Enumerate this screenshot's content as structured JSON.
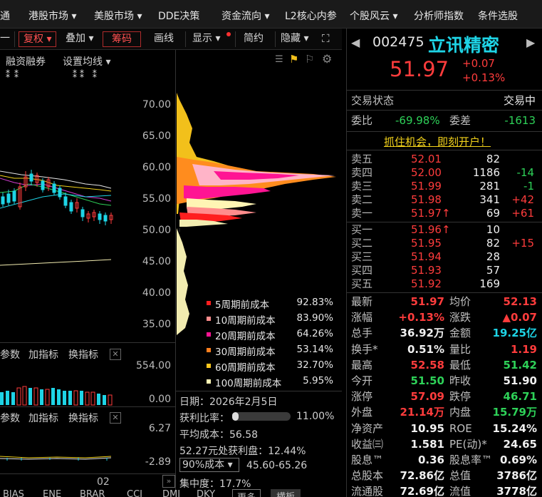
{
  "nav": {
    "items": [
      "通",
      "港股市场",
      "美股市场",
      "DDE决策",
      "资金流向",
      "L2核心内参",
      "个股风云",
      "分析师指数",
      "条件选股"
    ]
  },
  "toolbar": {
    "dash": "一",
    "fuquan": "复权",
    "diejia": "叠加",
    "chouma": "筹码",
    "huaxian": "画线",
    "xianshi": "显示",
    "jianyue": "简约",
    "yincang": "隐藏"
  },
  "subtoolbar": {
    "rongzi": "融资融券",
    "junxian": "设置均线"
  },
  "price_axis": [
    "70.00",
    "65.00",
    "60.00",
    "55.00",
    "50.00",
    "45.00",
    "40.00",
    "35.00"
  ],
  "chip_legend": [
    {
      "label": "5周期前成本",
      "value": "92.83%",
      "color": "#ff1e1e"
    },
    {
      "label": "10周期前成本",
      "value": "83.90%",
      "color": "#ff8c8c"
    },
    {
      "label": "20周期前成本",
      "value": "64.26%",
      "color": "#ff1493"
    },
    {
      "label": "30周期前成本",
      "value": "53.14%",
      "color": "#ff7f1e"
    },
    {
      "label": "60周期前成本",
      "value": "32.70%",
      "color": "#ffc81e"
    },
    {
      "label": "100周期前成本",
      "value": "5.95%",
      "color": "#fff5b4"
    }
  ],
  "vol_panel": {
    "params": "参数",
    "add": "加指标",
    "swap": "换指标",
    "close": "✕",
    "axis_top": "554.00",
    "axis_bottom": "0.00"
  },
  "macd_panel": {
    "params": "参数",
    "add": "加指标",
    "swap": "换指标",
    "close": "✕",
    "axis_top": "6.27",
    "axis_bottom": "-2.89"
  },
  "date_axis": {
    "label": "02"
  },
  "chip_info": {
    "date": "日期：2026年2月5日",
    "profit_label": "获利比率：",
    "profit_value": "11.00%",
    "avg_cost": "平均成本：56.58",
    "profit_at": "52.27元处获利盘：12.44%",
    "select": "90%成本",
    "range": "45.60-65.26",
    "concentration": "集中度：17.7%"
  },
  "bottom_tabs": [
    "BIAS",
    "ENE",
    "BRAR",
    "CCI",
    "DMI",
    "DKY",
    "更多",
    "横板"
  ],
  "stock": {
    "code": "002475",
    "name": "立讯精密",
    "price": "51.97",
    "change": "+0.07",
    "pct": "+0.13%"
  },
  "status": {
    "label": "交易状态",
    "value": "交易中"
  },
  "weibi": {
    "label": "委比",
    "value": "-69.98%",
    "diff_label": "委差",
    "diff_value": "-1613"
  },
  "promo": "抓住机会，即刻开户！",
  "asks": [
    {
      "label": "卖五",
      "price": "52.01",
      "vol": "82",
      "chg": ""
    },
    {
      "label": "卖四",
      "price": "52.00",
      "vol": "1186",
      "chg": "-14"
    },
    {
      "label": "卖三",
      "price": "51.99",
      "vol": "281",
      "chg": "-1"
    },
    {
      "label": "卖二",
      "price": "51.98",
      "vol": "341",
      "chg": "+42"
    },
    {
      "label": "卖一",
      "price": "51.97↑",
      "vol": "69",
      "chg": "+61"
    }
  ],
  "bids": [
    {
      "label": "买一",
      "price": "51.96↑",
      "vol": "10",
      "chg": ""
    },
    {
      "label": "买二",
      "price": "51.95",
      "vol": "82",
      "chg": "+15"
    },
    {
      "label": "买三",
      "price": "51.94",
      "vol": "28",
      "chg": ""
    },
    {
      "label": "买四",
      "price": "51.93",
      "vol": "57",
      "chg": ""
    },
    {
      "label": "买五",
      "price": "51.92",
      "vol": "169",
      "chg": ""
    }
  ],
  "stats": [
    {
      "l1": "最新",
      "v1": "51.97",
      "c1": "red",
      "l2": "均价",
      "v2": "52.13",
      "c2": "red"
    },
    {
      "l1": "涨幅",
      "v1": "+0.13%",
      "c1": "red",
      "l2": "涨跌",
      "v2": "▲0.07",
      "c2": "red"
    },
    {
      "l1": "总手",
      "v1": "36.92万",
      "c1": "white",
      "l2": "金额",
      "v2": "19.25亿",
      "c2": "cyan"
    },
    {
      "l1": "换手*",
      "v1": "0.51%",
      "c1": "white",
      "l2": "量比",
      "v2": "1.19",
      "c2": "red"
    },
    {
      "l1": "最高",
      "v1": "52.58",
      "c1": "red",
      "l2": "最低",
      "v2": "51.42",
      "c2": "green"
    },
    {
      "l1": "今开",
      "v1": "51.50",
      "c1": "green",
      "l2": "昨收",
      "v2": "51.90",
      "c2": "white"
    },
    {
      "l1": "涨停",
      "v1": "57.09",
      "c1": "red",
      "l2": "跌停",
      "v2": "46.71",
      "c2": "green"
    },
    {
      "l1": "外盘",
      "v1": "21.14万",
      "c1": "red",
      "l2": "内盘",
      "v2": "15.79万",
      "c2": "green"
    },
    {
      "l1": "净资产",
      "v1": "10.95",
      "c1": "white",
      "l2": "ROE",
      "v2": "15.24%",
      "c2": "white"
    },
    {
      "l1": "收益㈢",
      "v1": "1.581",
      "c1": "white",
      "l2": "PE(动)*",
      "v2": "24.65",
      "c2": "white"
    },
    {
      "l1": "股息™",
      "v1": "0.36",
      "c1": "white",
      "l2": "股息率™",
      "v2": "0.69%",
      "c2": "white"
    },
    {
      "l1": "总股本",
      "v1": "72.86亿",
      "c1": "white",
      "l2": "总值",
      "v2": "3786亿",
      "c2": "white"
    },
    {
      "l1": "流通股",
      "v1": "72.69亿",
      "c1": "white",
      "l2": "流值",
      "v2": "3778亿",
      "c2": "white"
    }
  ]
}
